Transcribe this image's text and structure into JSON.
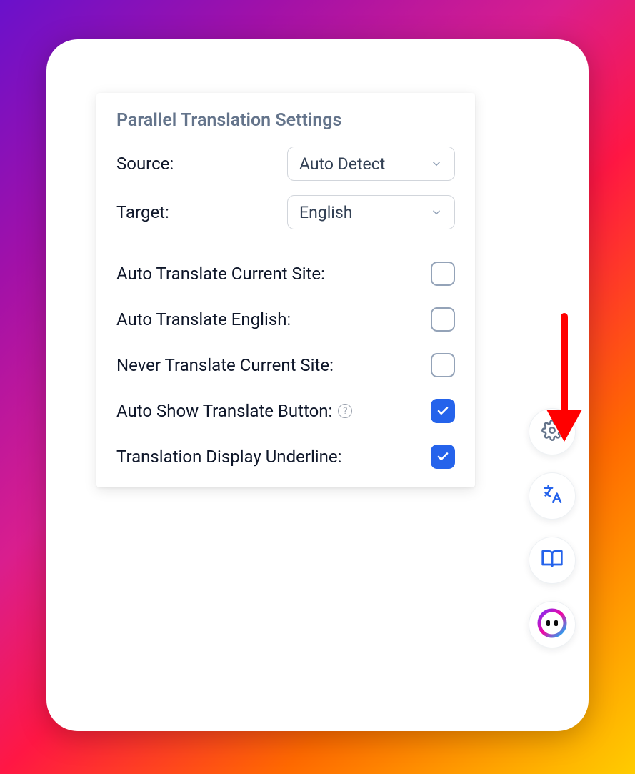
{
  "panel": {
    "title": "Parallel Translation Settings",
    "source_label": "Source:",
    "target_label": "Target:",
    "source_value": "Auto Detect",
    "target_value": "English"
  },
  "toggles": {
    "t1": {
      "label": "Auto Translate Current Site:",
      "checked": false
    },
    "t2": {
      "label": "Auto Translate English:",
      "checked": false
    },
    "t3": {
      "label": "Never Translate Current Site:",
      "checked": false
    },
    "t4": {
      "label": "Auto Show Translate Button:",
      "checked": true,
      "help": true
    },
    "t5": {
      "label": "Translation Display Underline:",
      "checked": true
    }
  },
  "help_glyph": "?",
  "sidebar": {
    "settings": "settings",
    "translate": "translate",
    "book": "book",
    "brand": "brand"
  },
  "colors": {
    "accent": "#2563eb",
    "muted": "#64748b"
  }
}
